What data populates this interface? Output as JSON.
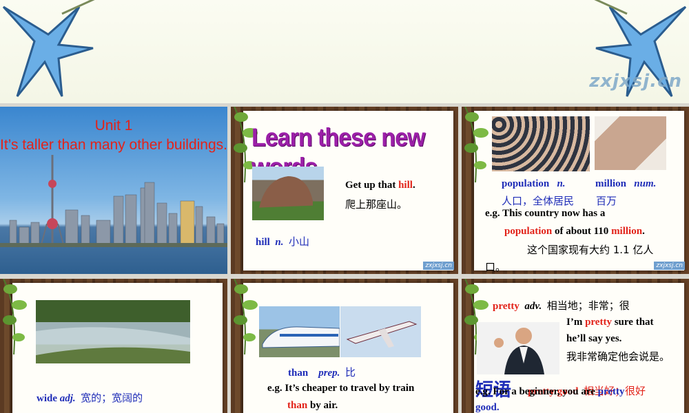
{
  "banner": {
    "watermark": "zxjxsj.cn"
  },
  "slide1": {
    "unit": "Unit 1",
    "title": "It’s taller than many other buildings."
  },
  "slide2": {
    "heading": "Learn these new words.",
    "sentence_pre": "Get up that ",
    "sentence_kw": "hill",
    "sentence_post": ".",
    "sentence_cn": "爬上那座山。",
    "word": "hill",
    "pos": "n.",
    "meaning": "小山",
    "logo": "zxjxsj.cn"
  },
  "slide3": {
    "word1": "population",
    "pos1": "n.",
    "meaning1": "人口，全体居民",
    "word2": "million",
    "pos2": "num.",
    "meaning2": "百万",
    "eg_line1": "e.g. This country now has a",
    "eg_kw1": "population",
    "eg_mid": " of about 110 ",
    "eg_kw2": "million",
    "eg_end": ".",
    "cn_line1": "这个国家现有大约 1.1 亿人",
    "cn_line2": "口。",
    "logo": "zxjxsj.cn"
  },
  "slide4": {
    "word": "wide",
    "pos": "adj.",
    "meaning": "宽的；宽阔的"
  },
  "slide5": {
    "word": "than",
    "pos": "prep.",
    "meaning": "比",
    "eg_line1": "e.g. It’s cheaper to travel by train",
    "eg_kw": "than",
    "eg_end": " by air."
  },
  "slide6": {
    "word": "pretty",
    "pos": "adv.",
    "meaning": "相当地；非常；很",
    "s1_pre": "I’m ",
    "s1_kw": "pretty",
    "s1_post": " sure that",
    "s2": "he’ll say yes.",
    "s3": "我非常确定他会说是。",
    "phrase_heading": "短语",
    "phrase": "pretty good",
    "phrase_cn": "相当好；很好",
    "eg_pre": "e.g. For a beginner, you are ",
    "eg_kw": "pretty",
    "eg_line2": "good."
  }
}
